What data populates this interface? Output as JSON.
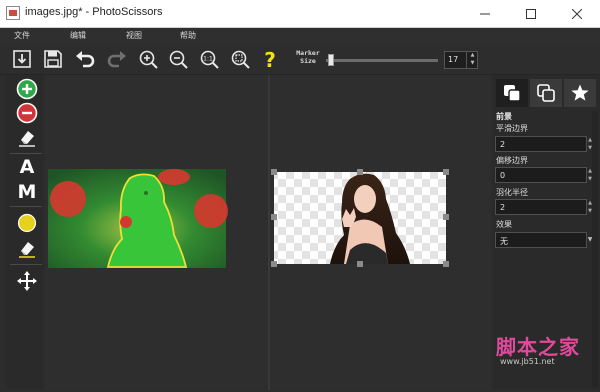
{
  "window": {
    "title": "images.jpg* - PhotoScissors"
  },
  "menu": [
    "文件",
    "编辑",
    "视图",
    "帮助"
  ],
  "toolbar": {
    "marker_label_line1": "Marker",
    "marker_label_line2": "Size",
    "marker_size_value": "17",
    "marker_size_fraction": 0.02,
    "icons": [
      "open-image-icon",
      "save-icon",
      "undo-icon",
      "redo-icon",
      "zoom-in-icon",
      "zoom-out-icon",
      "zoom-actual-size-icon",
      "zoom-fit-icon",
      "help-icon"
    ]
  },
  "left_tools": {
    "letter_a": "A",
    "letter_m": "M",
    "icons": [
      "keep-marker-icon",
      "remove-marker-icon",
      "eraser-icon",
      "auto-mode",
      "manual-mode",
      "hair-marker-icon",
      "hair-eraser-icon",
      "pan-icon"
    ]
  },
  "right_panel": {
    "tabs": [
      "background-tab-icon",
      "foreground-tab-icon",
      "effects-tab-icon"
    ],
    "section_title": "前景",
    "fields": [
      {
        "label": "平滑边界",
        "value": "2"
      },
      {
        "label": "偏移边界",
        "value": "0"
      },
      {
        "label": "羽化半径",
        "value": "2"
      }
    ],
    "effect_label": "效果",
    "effect_value": "无"
  },
  "watermark": {
    "brand": "脚本之家",
    "url": "www.jb51.net"
  },
  "colors": {
    "accent_keep": "#2fa84a",
    "accent_remove": "#d2343a",
    "hair_marker": "#e6d21c",
    "watermark_pink": "#e04a9a"
  }
}
